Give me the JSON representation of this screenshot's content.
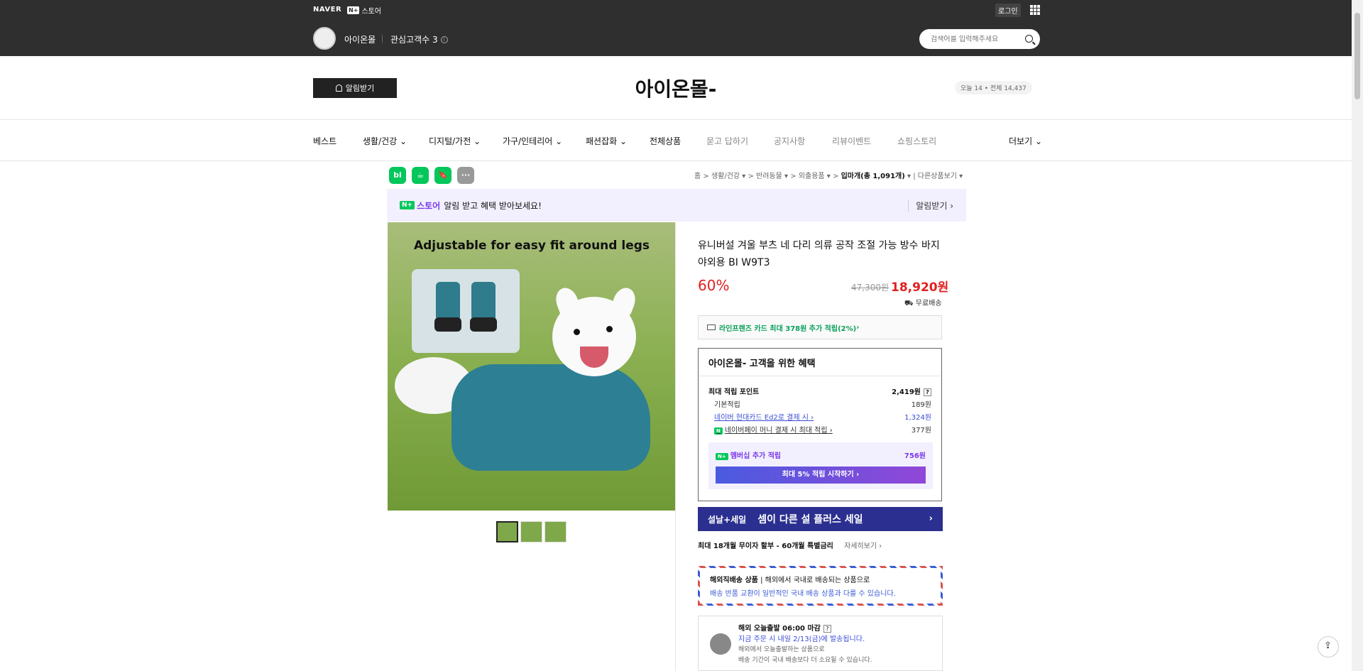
{
  "topbar": {
    "naver": "NAVER",
    "store_badge": "N+",
    "store_label": "스토어",
    "login": "로그인",
    "shop_name": "아이온몰",
    "followers": "관심고객수 3",
    "search_placeholder": "검색어를 입력해주세요"
  },
  "header": {
    "alarm_button": "알림받기",
    "shop_title": "아이온몰-",
    "visitors": "오늘 14 • 전체 14,437"
  },
  "nav": {
    "items": [
      "베스트",
      "생활/건강",
      "디지털/가전",
      "가구/인테리어",
      "패션잡화",
      "전체상품",
      "묻고 답하기",
      "공지사항",
      "리뷰이벤트",
      "쇼핑스토리"
    ],
    "more": "더보기"
  },
  "actions": [
    "bi",
    "☕",
    "🔖",
    "···"
  ],
  "breadcrumb": {
    "home": "홈",
    "cat1": "생활/건강",
    "cat2": "반려동물",
    "cat3": "외출용품",
    "current": "입마개(총 1,091개)",
    "other": "다른상품보기"
  },
  "promo": {
    "np": "N+",
    "store": "스토어",
    "text": "알림 받고 혜택 받아보세요!",
    "action": "알림받기"
  },
  "product": {
    "image_caption": "Adjustable for easy fit around legs",
    "title": "유니버설 겨울 부츠 네 다리 의류 공작 조절 가능 방수 바지 야외용 BI W9T3",
    "discount": "60%",
    "original_price": "47,300원",
    "sale_price": "18,920원",
    "shipping": "무료배송"
  },
  "card_benefit": "라인프렌즈 카드 최대 378원 추가 적립(2%)",
  "benefits": {
    "title": "아이온몰- 고객을 위한 혜택",
    "max_point_label": "최대 적립 포인트",
    "max_point_value": "2,419원",
    "rows": [
      {
        "label": "기본적립",
        "value": "189원"
      },
      {
        "label": "네이버 현대카드 Ed2로 결제 시",
        "value": "1,324원"
      },
      {
        "label": "네이버페이 머니 결제 시 최대 적립",
        "value": "377원"
      }
    ],
    "membership_label": "멤버십 추가 적립",
    "membership_value": "756원",
    "membership_button": "최대 5% 적립 시작하기"
  },
  "sale_banner": {
    "left": "설날+세일",
    "main": "셈이 다른 설 플러스 세일"
  },
  "installment": {
    "text": "최대 18개월 무이자 할부 - 60개월 특별금리",
    "detail": "자세히보기"
  },
  "overseas": {
    "title": "해외직배송 상품",
    "desc": "해외에서 국내로 배송되는 상품으로",
    "line2": "배송 반품 교환이 일반적인 국내 배송 상품과 다를 수 있습니다."
  },
  "shipping_info": {
    "line1": "해외 오늘출발 06:00 마감",
    "line2": "지금 주문 시 내일 2/13(금)에 발송됩니다.",
    "line3": "해외에서 오늘출발하는 상품으로",
    "line4": "배송 기간이 국내 배송보다 더 소요될 수 있습니다."
  }
}
